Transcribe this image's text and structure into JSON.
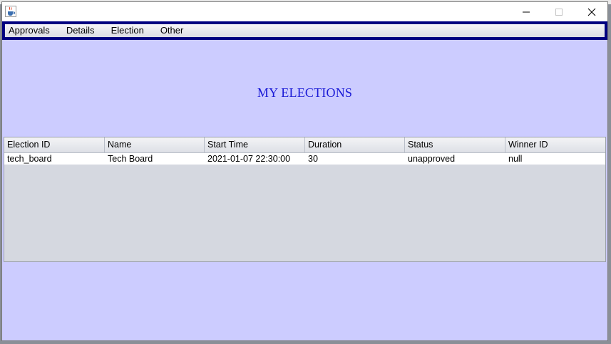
{
  "menu": {
    "items": [
      {
        "label": "Approvals"
      },
      {
        "label": "Details"
      },
      {
        "label": "Election"
      },
      {
        "label": "Other"
      }
    ]
  },
  "heading": "MY ELECTIONS",
  "table": {
    "columns": [
      "Election ID",
      "Name",
      "Start Time",
      "Duration",
      "Status",
      "Winner ID"
    ],
    "rows": [
      [
        "tech_board",
        "Tech Board",
        "2021-01-07 22:30:00",
        "30",
        "unapproved",
        "null"
      ]
    ]
  },
  "colors": {
    "background": "#ccccff",
    "menu_border": "#000080",
    "heading": "#1a1ad6",
    "table_empty": "#d5d8e0"
  },
  "icons": {
    "app": "java-cup-icon",
    "minimize": "minimize-icon",
    "maximize": "maximize-icon",
    "close": "close-icon"
  }
}
